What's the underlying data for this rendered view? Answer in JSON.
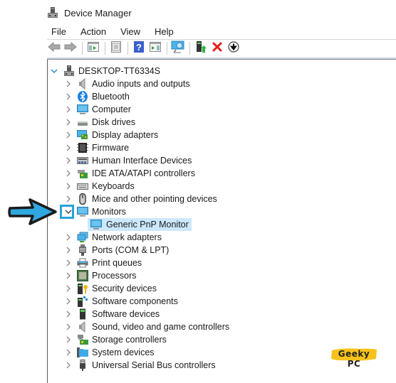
{
  "window": {
    "title": "Device Manager",
    "icon": "computer-tower-icon"
  },
  "menu": {
    "items": [
      "File",
      "Action",
      "View",
      "Help"
    ]
  },
  "toolbar": {
    "buttons": [
      {
        "name": "back",
        "icon": "back-arrow-icon"
      },
      {
        "name": "forward",
        "icon": "forward-arrow-icon"
      },
      {
        "name": "show-hide-console-tree",
        "icon": "console-tree-icon"
      },
      {
        "name": "properties",
        "icon": "properties-icon"
      },
      {
        "name": "help",
        "icon": "help-icon"
      },
      {
        "name": "show-hide-action-pane",
        "icon": "action-pane-icon"
      },
      {
        "name": "scan-hardware",
        "icon": "monitor-scan-icon"
      },
      {
        "name": "update-driver",
        "icon": "update-driver-icon"
      },
      {
        "name": "uninstall-device",
        "icon": "red-x-icon"
      },
      {
        "name": "disable-device",
        "icon": "down-arrow-circle-icon"
      }
    ]
  },
  "tree": {
    "root": {
      "label": "DESKTOP-TT6334S",
      "icon": "computer-tower-icon",
      "expanded": true
    },
    "categories": [
      {
        "label": "Audio inputs and outputs",
        "icon": "speaker-icon"
      },
      {
        "label": "Bluetooth",
        "icon": "bluetooth-icon"
      },
      {
        "label": "Computer",
        "icon": "monitor-icon"
      },
      {
        "label": "Disk drives",
        "icon": "disk-drive-icon"
      },
      {
        "label": "Display adapters",
        "icon": "display-adapter-icon"
      },
      {
        "label": "Firmware",
        "icon": "chip-icon"
      },
      {
        "label": "Human Interface Devices",
        "icon": "hid-icon"
      },
      {
        "label": "IDE ATA/ATAPI controllers",
        "icon": "ide-controller-icon"
      },
      {
        "label": "Keyboards",
        "icon": "keyboard-icon"
      },
      {
        "label": "Mice and other pointing devices",
        "icon": "mouse-icon"
      },
      {
        "label": "Monitors",
        "icon": "monitor-icon",
        "expanded": true,
        "children": [
          {
            "label": "Generic PnP Monitor",
            "icon": "monitor-icon",
            "selected": true
          }
        ]
      },
      {
        "label": "Network adapters",
        "icon": "network-icon"
      },
      {
        "label": "Ports (COM & LPT)",
        "icon": "port-icon"
      },
      {
        "label": "Print queues",
        "icon": "printer-icon"
      },
      {
        "label": "Processors",
        "icon": "processor-icon"
      },
      {
        "label": "Security devices",
        "icon": "security-key-icon"
      },
      {
        "label": "Software components",
        "icon": "software-component-icon"
      },
      {
        "label": "Software devices",
        "icon": "software-device-icon"
      },
      {
        "label": "Sound, video and game controllers",
        "icon": "speaker-icon"
      },
      {
        "label": "Storage controllers",
        "icon": "storage-controller-icon"
      },
      {
        "label": "System devices",
        "icon": "system-folder-icon"
      },
      {
        "label": "Universal Serial Bus controllers",
        "icon": "usb-icon"
      }
    ]
  },
  "annotation": {
    "arrow_color": "#2fa8e0",
    "highlight_color": "#29a3dc"
  },
  "watermark": {
    "text": "Geeky PC",
    "color": "#f7c21b"
  }
}
